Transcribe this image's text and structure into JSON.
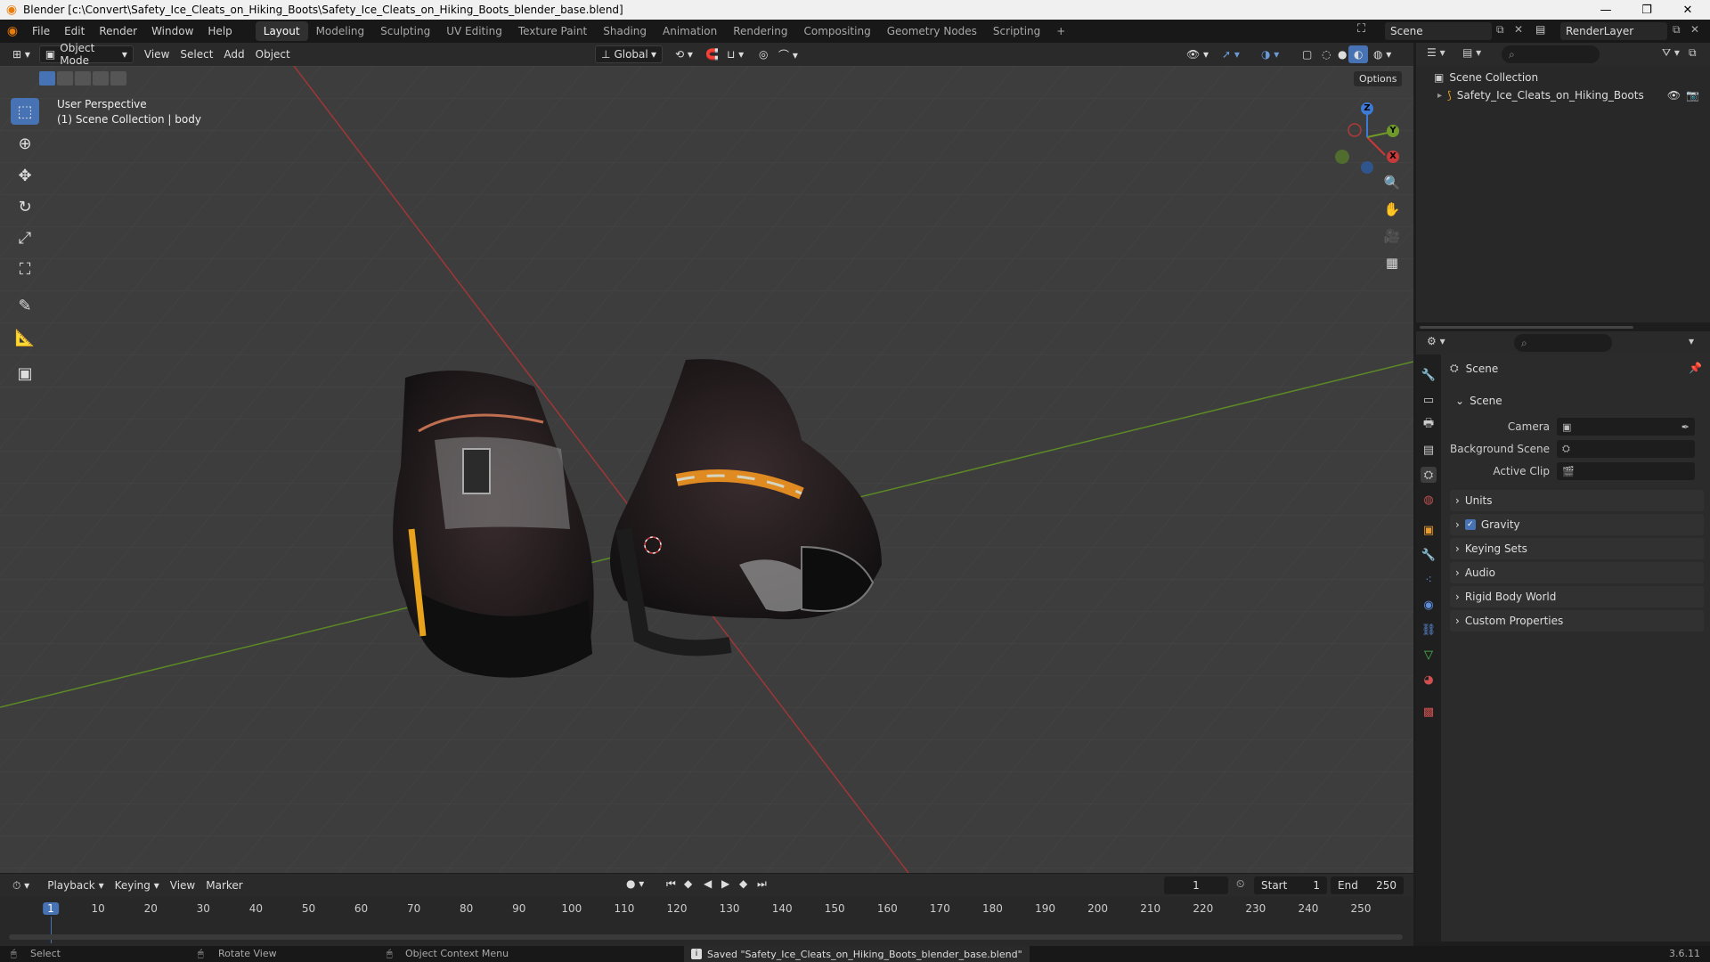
{
  "titlebar": {
    "title": "Blender [c:\\Convert\\Safety_Ice_Cleats_on_Hiking_Boots\\Safety_Ice_Cleats_on_Hiking_Boots_blender_base.blend]",
    "minimize": "—",
    "maximize": "❐",
    "close": "✕"
  },
  "menu": [
    "File",
    "Edit",
    "Render",
    "Window",
    "Help"
  ],
  "workspaces": [
    "Layout",
    "Modeling",
    "Sculpting",
    "UV Editing",
    "Texture Paint",
    "Shading",
    "Animation",
    "Rendering",
    "Compositing",
    "Geometry Nodes",
    "Scripting"
  ],
  "workspace_add": "+",
  "scene_name": "Scene",
  "render_layer": "RenderLayer",
  "viewport_header": {
    "mode": "Object Mode",
    "menus": [
      "View",
      "Select",
      "Add",
      "Object"
    ],
    "transform_orientation": "Global",
    "options": "Options"
  },
  "viewport": {
    "perspective": "User Perspective",
    "collection_info": "(1) Scene Collection | body",
    "gizmo_axes": [
      "X",
      "Y",
      "Z"
    ]
  },
  "outliner": {
    "root": "Scene Collection",
    "items": [
      "Safety_Ice_Cleats_on_Hiking_Boots"
    ]
  },
  "properties": {
    "context": "Scene",
    "section_scene": "Scene",
    "fields": [
      {
        "label": "Camera",
        "value": ""
      },
      {
        "label": "Background Scene",
        "value": ""
      },
      {
        "label": "Active Clip",
        "value": ""
      }
    ],
    "sections": [
      "Units",
      "Gravity",
      "Keying Sets",
      "Audio",
      "Rigid Body World",
      "Custom Properties"
    ]
  },
  "timeline": {
    "menus": [
      "Playback",
      "Keying",
      "View",
      "Marker"
    ],
    "current_frame": "1",
    "start_label": "Start",
    "start": "1",
    "end_label": "End",
    "end": "250",
    "ticks": [
      "1",
      "10",
      "20",
      "30",
      "40",
      "50",
      "60",
      "70",
      "80",
      "90",
      "100",
      "110",
      "120",
      "130",
      "140",
      "150",
      "160",
      "170",
      "180",
      "190",
      "200",
      "210",
      "220",
      "230",
      "240",
      "250"
    ]
  },
  "statusbar": {
    "select": "Select",
    "rotate": "Rotate View",
    "context_menu": "Object Context Menu",
    "message": "Saved \"Safety_Ice_Cleats_on_Hiking_Boots_blender_base.blend\"",
    "version": "3.6.11"
  },
  "colors": {
    "accent": "#4772b3",
    "x_axis": "#c83a3a",
    "y_axis": "#6f9a2a",
    "z_axis": "#3d7ad6"
  }
}
